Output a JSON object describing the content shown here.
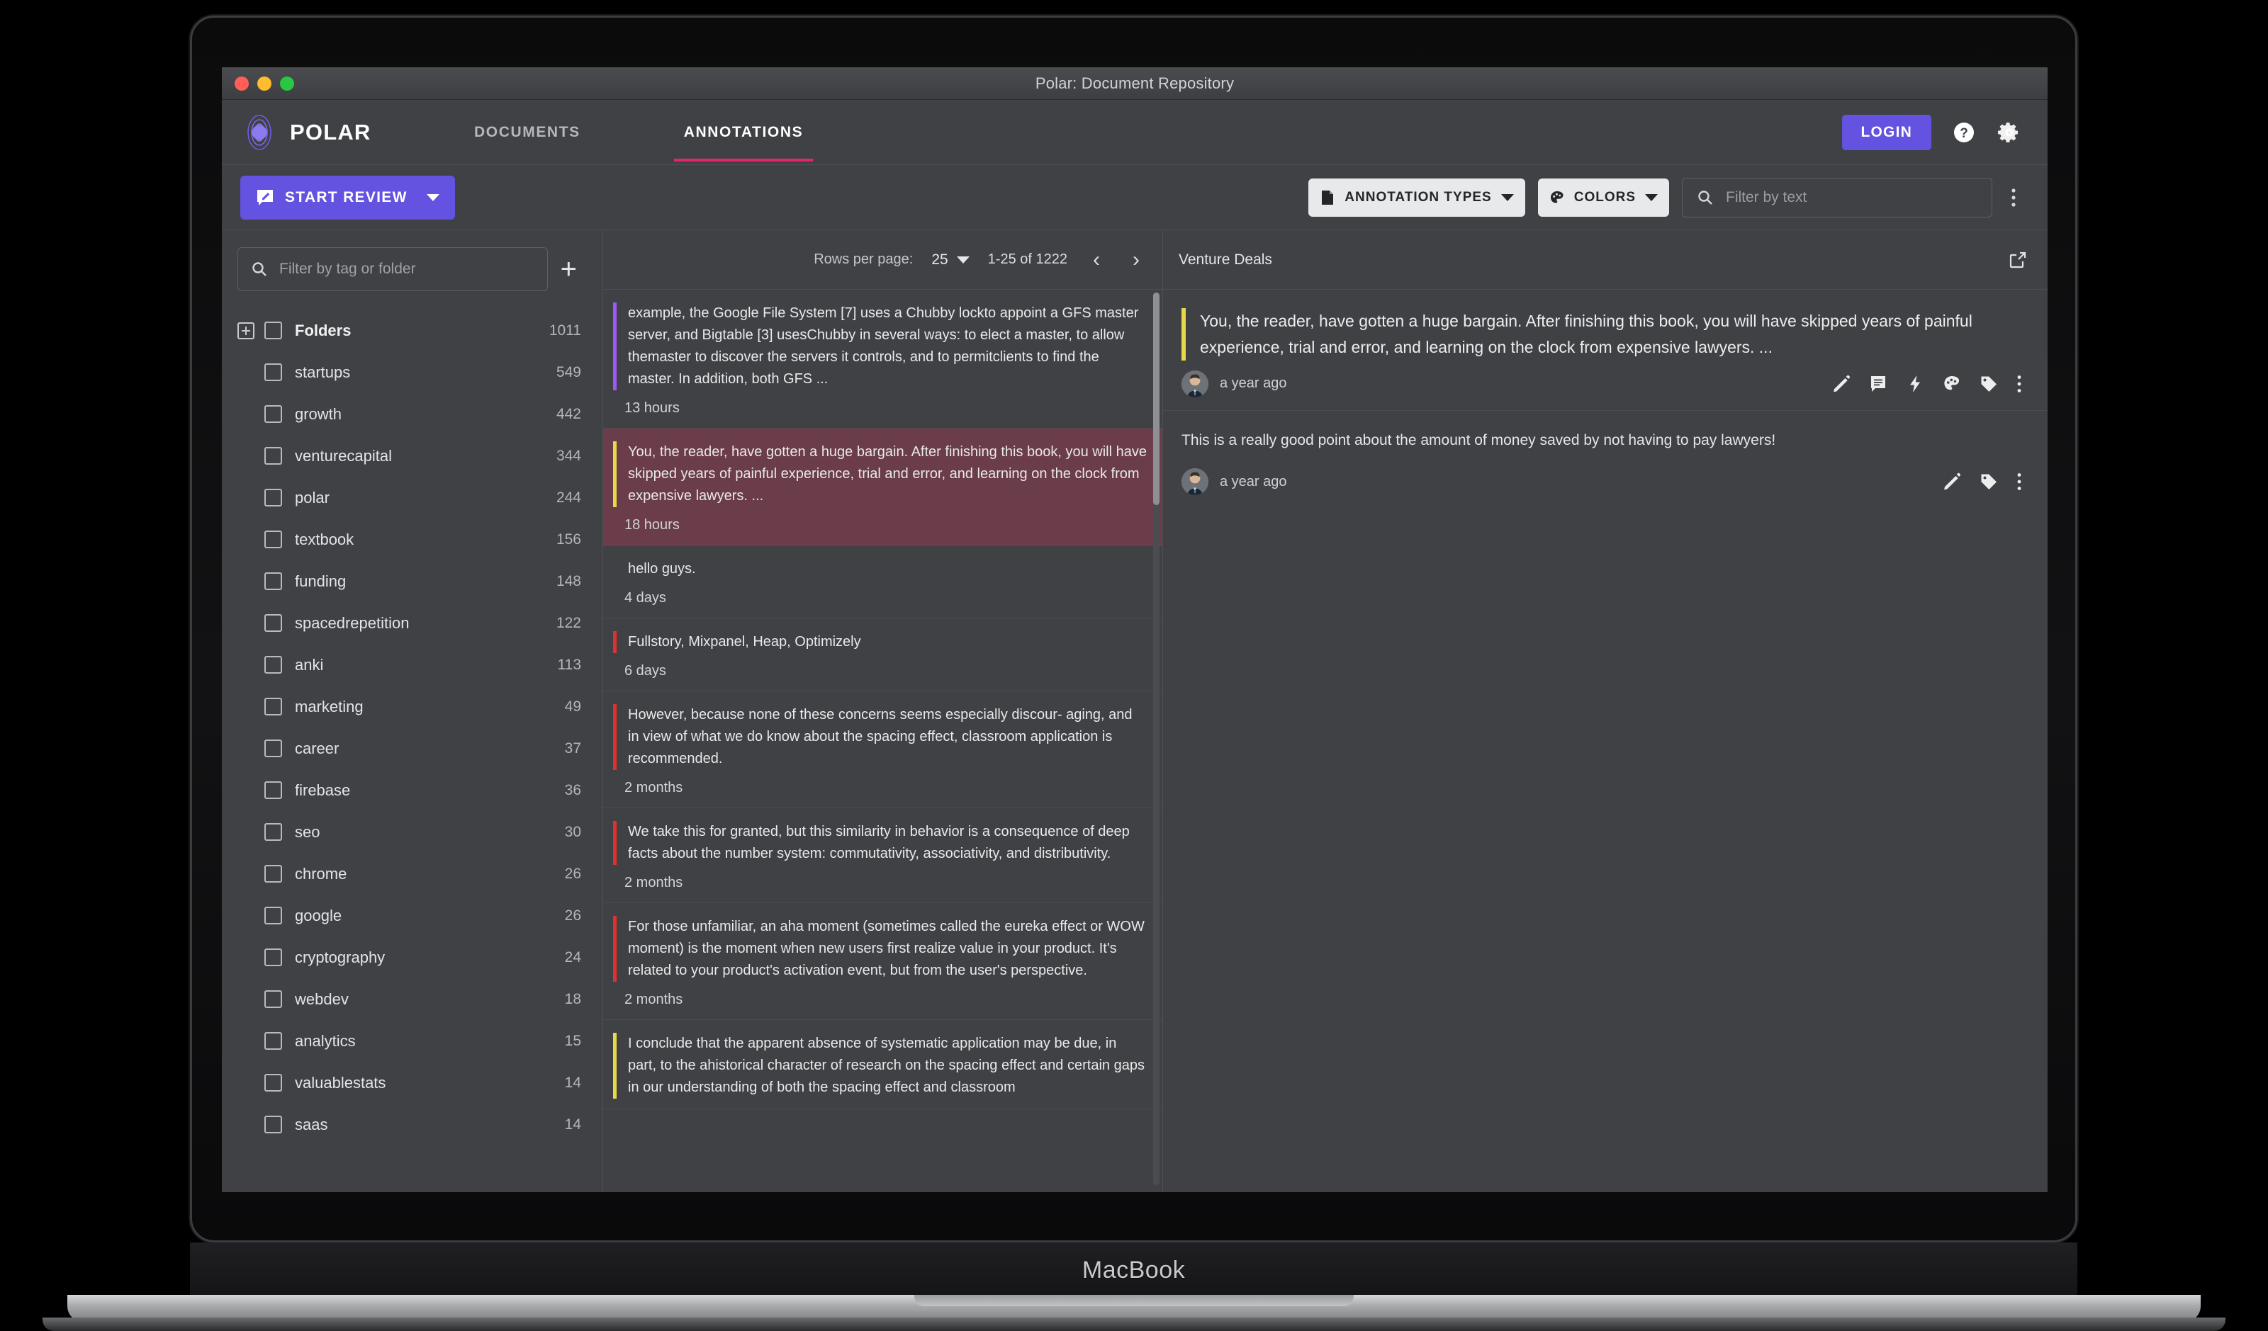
{
  "window": {
    "title": "Polar: Document Repository",
    "device_label": "MacBook"
  },
  "nav": {
    "brand": "POLAR",
    "logo_icon": "polar-orb-logo",
    "tabs": [
      {
        "label": "DOCUMENTS",
        "active": false
      },
      {
        "label": "ANNOTATIONS",
        "active": true
      }
    ],
    "active_tab_underline_color": "#e4246b",
    "login_label": "LOGIN",
    "login_color": "#6452e0",
    "help_icon": "help-circle-icon",
    "settings_icon": "gear-icon"
  },
  "toolbar": {
    "start_review_label": "START REVIEW",
    "start_review_icon": "review-flashcard-icon",
    "annotation_types_label": "ANNOTATION TYPES",
    "annotation_types_icon": "document-icon",
    "colors_label": "COLORS",
    "colors_icon": "palette-icon",
    "filter_placeholder": "Filter by text",
    "filter_value": "",
    "search_icon": "search-icon",
    "more_icon": "vertical-dots-icon"
  },
  "sidebar": {
    "filter_placeholder": "Filter by tag or folder",
    "filter_value": "",
    "search_icon": "search-icon",
    "add_icon": "plus-icon",
    "items": [
      {
        "label": "Folders",
        "count": "1011",
        "folder": true
      },
      {
        "label": "startups",
        "count": "549",
        "folder": false
      },
      {
        "label": "growth",
        "count": "442",
        "folder": false
      },
      {
        "label": "venturecapital",
        "count": "344",
        "folder": false
      },
      {
        "label": "polar",
        "count": "244",
        "folder": false
      },
      {
        "label": "textbook",
        "count": "156",
        "folder": false
      },
      {
        "label": "funding",
        "count": "148",
        "folder": false
      },
      {
        "label": "spacedrepetition",
        "count": "122",
        "folder": false
      },
      {
        "label": "anki",
        "count": "113",
        "folder": false
      },
      {
        "label": "marketing",
        "count": "49",
        "folder": false
      },
      {
        "label": "career",
        "count": "37",
        "folder": false
      },
      {
        "label": "firebase",
        "count": "36",
        "folder": false
      },
      {
        "label": "seo",
        "count": "30",
        "folder": false
      },
      {
        "label": "chrome",
        "count": "26",
        "folder": false
      },
      {
        "label": "google",
        "count": "26",
        "folder": false
      },
      {
        "label": "cryptography",
        "count": "24",
        "folder": false
      },
      {
        "label": "webdev",
        "count": "18",
        "folder": false
      },
      {
        "label": "analytics",
        "count": "15",
        "folder": false
      },
      {
        "label": "valuablestats",
        "count": "14",
        "folder": false
      },
      {
        "label": "saas",
        "count": "14",
        "folder": false
      }
    ]
  },
  "annotation_list": {
    "rows_per_page_label": "Rows per page:",
    "rows_per_page_value": "25",
    "page_range": "1-25 of 1222",
    "prev_icon": "chevron-left-icon",
    "next_icon": "chevron-right-icon",
    "items": [
      {
        "text": "example, the Google File System [7] uses a Chubby lockto appoint a GFS master server, and Bigtable [3] usesChubby in several ways: to elect a master, to allow themaster to discover the servers it controls, and to permitclients to find the master. In addition, both GFS ...",
        "time": "13 hours",
        "bar_color": "#9b59f6",
        "selected": false
      },
      {
        "text": "You, the reader, have gotten a huge bargain. After finishing this book, you will have skipped years of painful experience, trial and error, and learning on the clock from expensive lawyers. ...",
        "time": "18 hours",
        "bar_color": "#e6d94a",
        "selected": true
      },
      {
        "text": "hello guys.",
        "time": "4 days",
        "bar_color": "",
        "selected": false
      },
      {
        "text": "Fullstory, Mixpanel, Heap, Optimizely",
        "time": "6 days",
        "bar_color": "#e03131",
        "selected": false
      },
      {
        "text": "However, because none of these concerns seems especially discour- aging, and in view of what we do know about the spacing effect, classroom application is recommended.",
        "time": "2 months",
        "bar_color": "#e03131",
        "selected": false
      },
      {
        "text": "We take this for granted, but this similarity in behavior is a consequence of deep facts about the number system: commutativity, associativity, and distributivity.",
        "time": "2 months",
        "bar_color": "#e03131",
        "selected": false
      },
      {
        "text": "For those unfamiliar, an aha moment (sometimes called the eureka effect or WOW moment) is the moment when new users first realize value in your product. It's related to your product's activation event, but from the user's perspective.",
        "time": "2 months",
        "bar_color": "#e03131",
        "selected": false
      },
      {
        "text": "I conclude that the apparent absence of systematic application may be due, in part, to the ahistorical character of research on the spacing effect and certain gaps in our understanding of both the spacing effect and classroom",
        "time": "",
        "bar_color": "#e6d94a",
        "selected": false
      }
    ]
  },
  "detail": {
    "doc_title": "Venture Deals",
    "open_icon": "external-link-icon",
    "quote": "You, the reader, have gotten a huge bargain. After finishing this book, you will have skipped years of painful experience, trial and error, and learning on the clock from expensive lawyers. ...",
    "quote_bar_color": "#e6d94a",
    "annotation_meta": {
      "avatar": "user-avatar",
      "time": "a year ago",
      "icons": [
        "edit-pencil-icon",
        "comment-icon",
        "flashcard-bolt-icon",
        "palette-icon",
        "tag-icon",
        "vertical-dots-icon"
      ]
    },
    "comment": {
      "text": "This is a really good point about the amount of money saved by not having to pay lawyers!",
      "avatar": "user-avatar",
      "time": "a year ago",
      "icons": [
        "edit-pencil-icon",
        "tag-icon",
        "vertical-dots-icon"
      ]
    }
  }
}
